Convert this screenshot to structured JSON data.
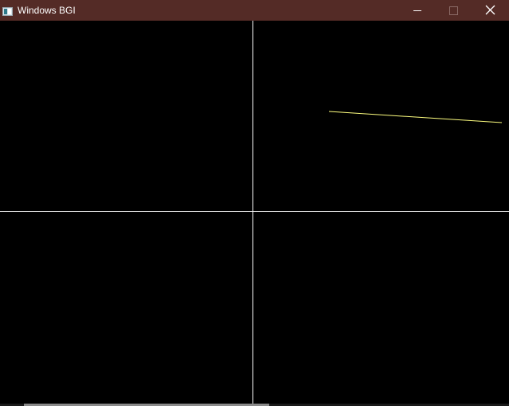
{
  "window": {
    "title": "Windows BGI",
    "title_bar_color": "#542b26",
    "icons": {
      "app": "bgi-app-icon",
      "minimize": "minimize-icon",
      "maximize": "maximize-icon",
      "close": "close-icon"
    }
  },
  "canvas": {
    "background_color": "#000000",
    "axis_color": "#ffffff",
    "line_color": "#ffff80"
  }
}
